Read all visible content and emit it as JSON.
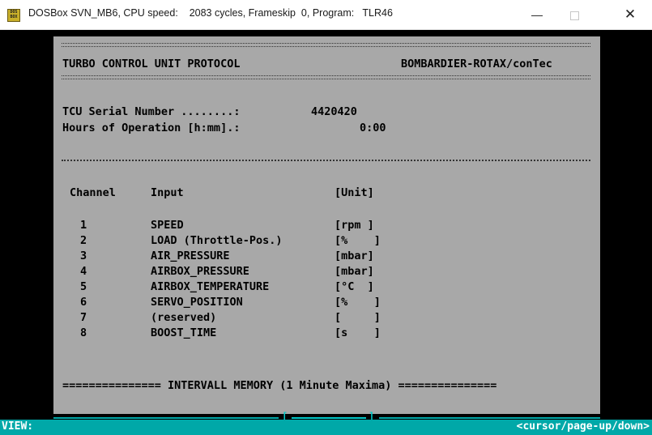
{
  "window": {
    "icon_text": "DOS BOX",
    "title": "DOSBox SVN_MB6, CPU speed:    2083 cycles, Frameskip  0, Program:   TLR46",
    "minimize_glyph": "—",
    "close_glyph": "✕"
  },
  "report": {
    "header_left": "TURBO CONTROL UNIT PROTOCOL",
    "header_right": "BOMBARDIER-ROTAX/conTec",
    "serial_label": "TCU Serial Number ........:",
    "serial_value": "4420420",
    "hours_label": "Hours of Operation [h:mm].:",
    "hours_value": "0:00",
    "col_channel": "Channel",
    "col_input": "Input",
    "col_unit": "[Unit]",
    "channels": [
      {
        "num": "1",
        "input": "SPEED",
        "unit": "[rpm ]"
      },
      {
        "num": "2",
        "input": "LOAD (Throttle-Pos.)",
        "unit": "[%    ]"
      },
      {
        "num": "3",
        "input": "AIR_PRESSURE",
        "unit": "[mbar]"
      },
      {
        "num": "4",
        "input": "AIRBOX_PRESSURE",
        "unit": "[mbar]"
      },
      {
        "num": "5",
        "input": "AIRBOX_TEMPERATURE",
        "unit": "[°C  ]"
      },
      {
        "num": "6",
        "input": "SERVO_POSITION",
        "unit": "[%    ]"
      },
      {
        "num": "7",
        "input": "(reserved)",
        "unit": "[     ]"
      },
      {
        "num": "8",
        "input": "BOOST_TIME",
        "unit": "[s    ]"
      }
    ],
    "footer": "=============== INTERVALL MEMORY (1 Minute Maxima) ==============="
  },
  "scroll": {
    "left_mark": "[",
    "right_mark": "]"
  },
  "status": {
    "mode": "VIEW:",
    "hint": "<cursor/page-up/down>"
  }
}
